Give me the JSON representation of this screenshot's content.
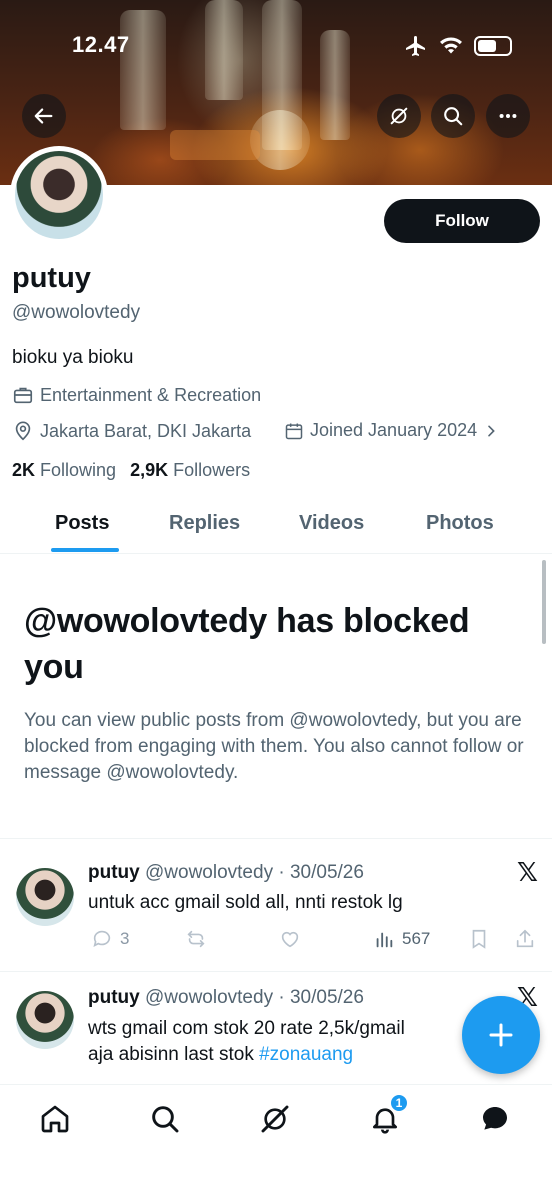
{
  "status_bar": {
    "time": "12.47"
  },
  "header": {
    "back_icon": "arrow-left-icon",
    "grok_icon": "grok-icon",
    "search_icon": "search-icon",
    "more_icon": "more-icon"
  },
  "profile": {
    "display_name": "putuy",
    "handle": "@wowolovtedy",
    "bio": "bioku ya bioku",
    "category": "Entertainment & Recreation",
    "location": "Jakarta Barat, DKI Jakarta",
    "joined": "Joined January 2024",
    "following_count": "2K",
    "following_label": "Following",
    "followers_count": "2,9K",
    "followers_label": "Followers",
    "follow_button": "Follow"
  },
  "tabs": [
    {
      "label": "Posts",
      "active": true
    },
    {
      "label": "Replies",
      "active": false
    },
    {
      "label": "Videos",
      "active": false
    },
    {
      "label": "Photos",
      "active": false
    }
  ],
  "blocked_notice": {
    "title": "@wowolovtedy has blocked you",
    "body": "You can view public posts from @wowolovtedy, but you are blocked from engaging with them. You also cannot follow or message @wowolovtedy."
  },
  "posts": [
    {
      "name": "putuy",
      "handle": "@wowolovtedy",
      "date": "30/05/26",
      "text": "untuk acc gmail sold all, nnti restok lg",
      "replies": "3",
      "views": "567"
    },
    {
      "name": "putuy",
      "handle": "@wowolovtedy",
      "date": "30/05/26",
      "text_line1": "wts gmail com stok 20 rate 2,5k/gmail",
      "text_line2_prefix": "aja abisinn last stok ",
      "hashtag": "#zonauang"
    }
  ],
  "bottom_nav": {
    "notifications_badge": "1"
  },
  "colors": {
    "accent": "#1d9bf0",
    "text_primary": "#0f1419",
    "text_secondary": "#536471"
  }
}
